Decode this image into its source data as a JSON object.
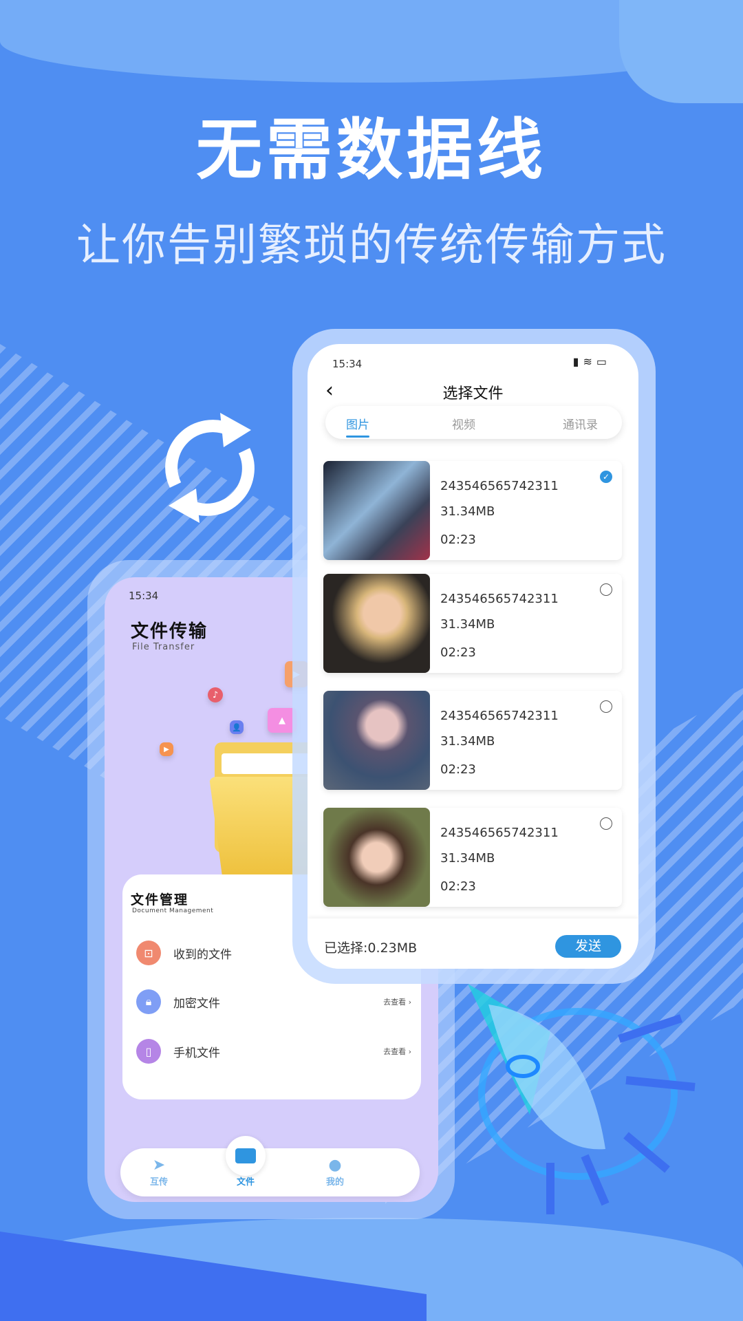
{
  "headline": "无需数据线",
  "subheadline": "让你告别繁琐的传统传输方式",
  "left_phone": {
    "status_time": "15:34",
    "title": "文件传输",
    "subtitle": "File Transfer",
    "card": {
      "title": "文件管理",
      "subtitle": "Document  Management",
      "items": [
        {
          "label": "收到的文件",
          "icon": "inbox-folder-icon",
          "color": "#f0896f"
        },
        {
          "label": "加密文件",
          "action": "去查看 ›",
          "icon": "lock-icon",
          "color": "#7f9ef5"
        },
        {
          "label": "手机文件",
          "action": "去查看 ›",
          "icon": "phone-icon",
          "color": "#b585e6"
        }
      ]
    },
    "nav": [
      {
        "label": "互传",
        "icon": "paper-plane-icon"
      },
      {
        "label": "文件",
        "icon": "folder-icon"
      },
      {
        "label": "我的",
        "icon": "chat-face-icon"
      }
    ]
  },
  "right_phone": {
    "status_time": "15:34",
    "title": "选择文件",
    "tabs": [
      {
        "label": "图片",
        "active": true
      },
      {
        "label": "视频"
      },
      {
        "label": "通讯录"
      }
    ],
    "files": [
      {
        "name": "243546565742311",
        "size": "31.34MB",
        "time": "02:23",
        "selected": true
      },
      {
        "name": "243546565742311",
        "size": "31.34MB",
        "time": "02:23",
        "selected": false
      },
      {
        "name": "243546565742311",
        "size": "31.34MB",
        "time": "02:23",
        "selected": false
      },
      {
        "name": "243546565742311",
        "size": "31.34MB",
        "time": "02:23",
        "selected": false
      }
    ],
    "selected_summary": "已选择:0.23MB",
    "send_label": "发送"
  },
  "colors": {
    "background": "#4f8ef2",
    "accent": "#2f95e0",
    "left_screen": "#d5cdfb"
  }
}
